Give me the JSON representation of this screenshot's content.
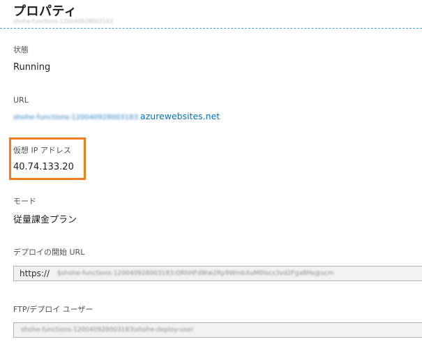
{
  "header": {
    "title": "プロパティ",
    "subtitle": "shohe-functions-120040928003183"
  },
  "properties": {
    "state": {
      "label": "状態",
      "value": "Running"
    },
    "url": {
      "label": "URL",
      "host_prefix": "shohe-functions-120040928003183.",
      "host_domain": "azurewebsites.net"
    },
    "virtual_ip": {
      "label": "仮想 IP アドレス",
      "value": "40.74.133.20"
    },
    "mode": {
      "label": "モード",
      "value": "従量課金プラン"
    },
    "deploy_trigger_url": {
      "label": "デプロイの開始 URL",
      "value_prefix": "https://",
      "value_rest": "$shohe-functions-120040928003183:QRhHFd9tw2Rp9WmbXuM0locs3vd2Fga8Hs@scm"
    },
    "ftp_user": {
      "label": "FTP/デプロイ ユーザー",
      "value": "shohe-functions-120040928003183\\shohe-deploy-user"
    }
  },
  "colors": {
    "link": "#0072c6",
    "highlight": "#f07d22",
    "header_rule": "#3fa5d8",
    "field_background": "#f2f2f2"
  }
}
